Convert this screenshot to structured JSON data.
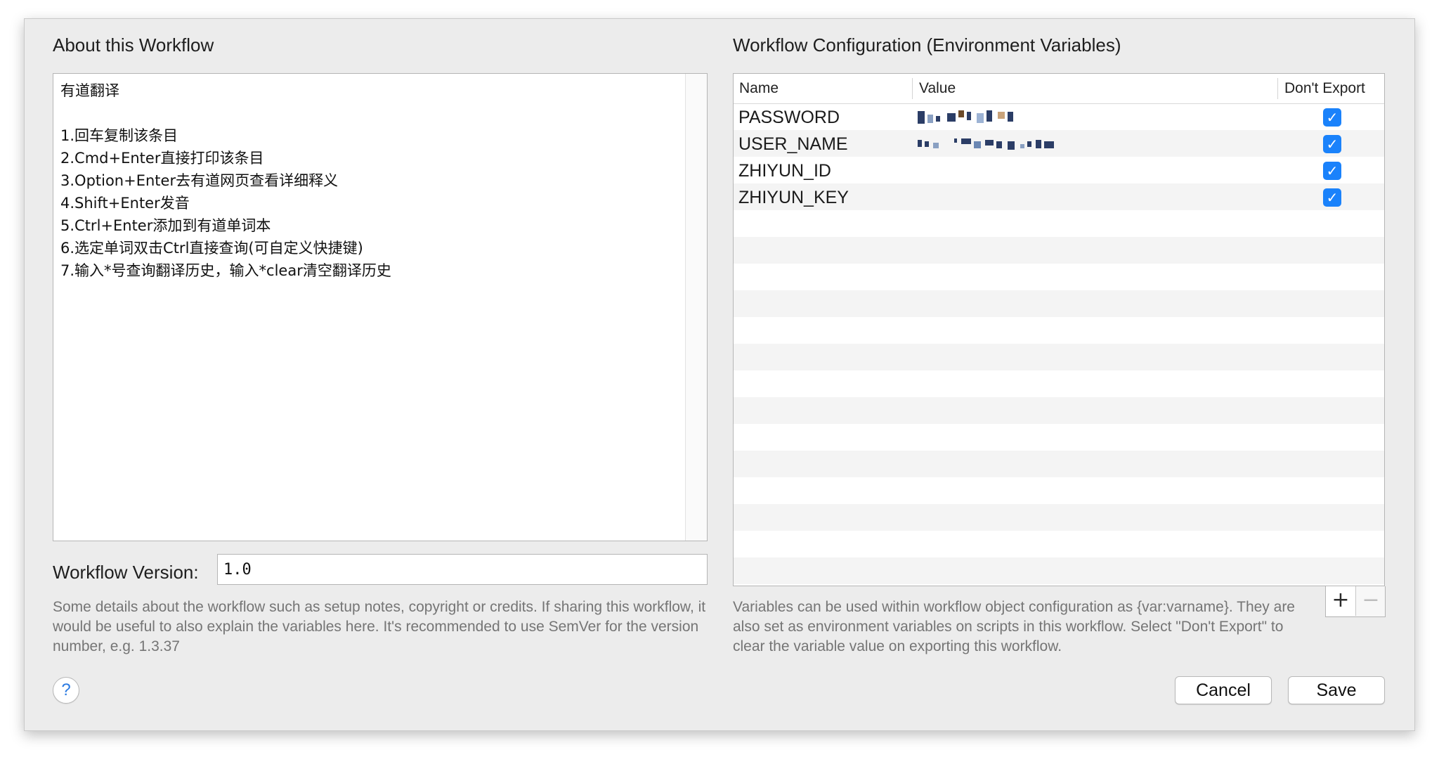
{
  "about": {
    "title": "About this Workflow",
    "description": "有道翻译\n\n1.回车复制该条目\n2.Cmd+Enter直接打印该条目\n3.Option+Enter去有道网页查看详细释义\n4.Shift+Enter发音\n5.Ctrl+Enter添加到有道单词本\n6.选定单词双击Ctrl直接查询(可自定义快捷键)\n7.输入*号查询翻译历史，输入*clear清空翻译历史",
    "version_label": "Workflow Version:",
    "version_value": "1.0",
    "help_text": "Some details about the workflow such as setup notes, copyright or credits. If sharing this workflow, it would be useful to also explain the variables here. It's recommended to use SemVer for the version number, e.g. 1.3.37"
  },
  "config": {
    "title": "Workflow Configuration (Environment Variables)",
    "columns": [
      "Name",
      "Value",
      "Don't Export"
    ],
    "rows": [
      {
        "name": "PASSWORD",
        "value": "",
        "dont_export": true
      },
      {
        "name": "USER_NAME",
        "value": "",
        "dont_export": true
      },
      {
        "name": "ZHIYUN_ID",
        "value": "",
        "dont_export": true
      },
      {
        "name": "ZHIYUN_KEY",
        "value": "",
        "dont_export": true
      }
    ],
    "help_text": "Variables can be used within workflow object configuration as {var:varname}. They are also set as environment variables on scripts in this workflow. Select \"Don't Export\" to clear the variable value on exporting this workflow.",
    "add_label": "+",
    "remove_label": "−"
  },
  "buttons": {
    "help": "?",
    "cancel": "Cancel",
    "save": "Save"
  },
  "colors": {
    "accent": "#1a82fb",
    "sheet_bg": "#ececec",
    "help_text": "#757575"
  },
  "icons": {
    "checkbox": "checkmark-icon",
    "help": "question-mark-icon",
    "add": "plus-icon",
    "remove": "minus-icon"
  }
}
